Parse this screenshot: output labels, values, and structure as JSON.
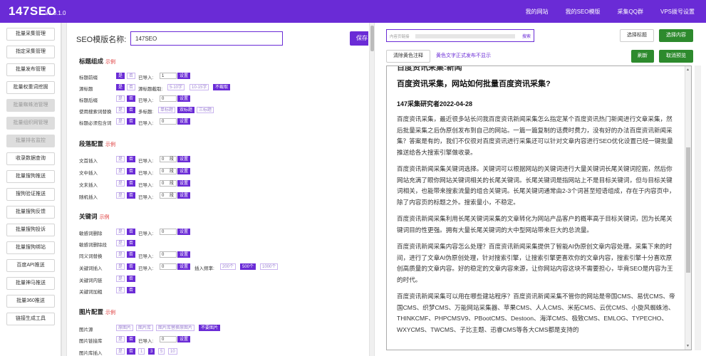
{
  "app": {
    "logo": "147SEO",
    "version": "v1.3.1.0"
  },
  "topnav": [
    "我的网站",
    "我的SEO模版",
    "采集QQ群",
    "VPS拨号设置"
  ],
  "sidebar": [
    {
      "label": "批量采集管理",
      "disabled": false
    },
    {
      "label": "指定采集管理",
      "disabled": false
    },
    {
      "label": "批量发布管理",
      "disabled": false
    },
    {
      "label": "批量权重词挖掘",
      "disabled": false
    },
    {
      "label": "批量蜘蛛池管理",
      "disabled": true
    },
    {
      "label": "批量组织网管理",
      "disabled": true
    },
    {
      "label": "批量排名监控",
      "disabled": true
    },
    {
      "label": "收录数据查询",
      "disabled": false
    },
    {
      "label": "批量搜狗推送",
      "disabled": false
    },
    {
      "label": "搜狗验证推送",
      "disabled": false
    },
    {
      "label": "批量搜狗反馈",
      "disabled": false
    },
    {
      "label": "批量搜狗投诉",
      "disabled": false
    },
    {
      "label": "批量搜狗绑站",
      "disabled": false
    },
    {
      "label": "百度API推送",
      "disabled": false
    },
    {
      "label": "批量神马推送",
      "disabled": false
    },
    {
      "label": "批量360推送",
      "disabled": false
    },
    {
      "label": "链接生成工具",
      "disabled": false
    }
  ],
  "template": {
    "label": "SEO模版名称:",
    "value": "147SEO",
    "save": "保存"
  },
  "example": "示例",
  "common": {
    "yes": "是",
    "no": "否",
    "imported": "已导入:",
    "set": "设置",
    "n0": "0",
    "n1": "1",
    "duan": "段"
  },
  "sections": {
    "title": {
      "heading": "标题组成",
      "rows": [
        "标题前缀",
        "源标题",
        "标题后缀",
        "使用搜索词替换",
        "标题必须包含词"
      ],
      "src_cut": "源标题截取:",
      "len1": "5-10字",
      "len2": "10-15字",
      "notcut": "不截取",
      "multi": "多标题:",
      "single": "单标题",
      "dbl": "双标题",
      "tri": "三标题"
    },
    "para": {
      "heading": "段落配置",
      "rows": [
        "文首插入",
        "文中插入",
        "文末插入",
        "随机插入"
      ]
    },
    "kw": {
      "heading": "关键词",
      "rows": [
        "敏感词删除",
        "敏感词删除段",
        "同义词替换",
        "关键词插入",
        "关键词内链",
        "关键词加粗"
      ],
      "freq": "插入频率:",
      "f200": "200个",
      "f500": "500个",
      "f1000": "1000个"
    },
    "img": {
      "heading": "图片配置",
      "rows": [
        "图片源",
        "图片链接库",
        "图片库插入"
      ],
      "src1": "原图片",
      "src2": "图片库",
      "src3": "图片库替换原图片",
      "noimg": "不要图片",
      "p1": "1",
      "p3": "3",
      "p5": "5",
      "p10": "10"
    }
  },
  "right": {
    "url_placeholder": "内容页链接",
    "search": "搜索",
    "select_title": "选择标题",
    "select_content": "选择内容",
    "clear_yellow": "清除黄色注释",
    "yellow_note": "黄色文字正式发布不显示",
    "refresh": "刷新",
    "cancel_preview": "取消预览"
  },
  "article": {
    "cut_line": "百度资讯采集:新闻",
    "title": "百度资讯采集，网站如何批量百度资讯采集?",
    "subtitle": "147采集研究者2022-04-28",
    "paragraphs": [
      "百度资讯采集，最近很多站长问我百度资讯新闻采集怎么指定某个百度资讯热门新闻进行文章采集，然后批量采集之后伪原创发布到自己的网站。一篇一篇复制的话费时费力，没有好的办法百度资讯新闻采集？答案是有的，我们不仅很对百度资讯进行采集还可以针对文章内容进行SEO优化设置已经一键批量推送给各大搜索引擎做收录。",
      "百度资讯新闻采集关键词选择。关键词可以根据网站的关键词进行大量关键词长尾关键词挖掘，然后你网站充满了眼你网站关键词相关的长尾关键词。长尾关键词是指网站上不是目标关键词，但与目标关键词相关，也能带来搜索流量的组合关键词。长尾关键词通常由2-3个词甚至短语组成，存在于内容页中，除了内容页的标题之外。搜索量小，不稳定。",
      "百度资讯新闻采集利用长尾关键词采集的文章转化为网站产品客户的概率高于目标关键词，因为长尾关键词目的性更强。拥有大量长尾关键词的大中型网站带来巨大的总流量。",
      "百度资讯新闻采集内容怎么处理？百度资讯新闻采集提供了智能AI伪原创文章内容处理。采集下来的时间，进行了文章AI伪原创处理，针对搜索引擎，让搜索引擎更喜欢你的文章内容，搜索引擎十分喜欢原创高质量的文章内容。好的稳定的文章内容来源，让你网站内容这块不需要担心，毕竟SEO是内容为王的时代。",
      "百度资讯新闻采集可以用在哪些建站程序？百度资讯新闻采集不管你的网站是帝国CMS、易优CMS、帝国CMS、织梦CMS、万能网站采集器、苹果CMS、人人CMS、米拓CMS、云优CMS、小旋风蜘蛛池、THINKCMF、PHPCMSV9、PBootCMS、Destoon、海洋CMS、极致CMS、EMLOG、TYPECHO、WXYCMS、TWCMS、子比主题、迅睿CMS等各大CMS都是支持的"
    ]
  }
}
